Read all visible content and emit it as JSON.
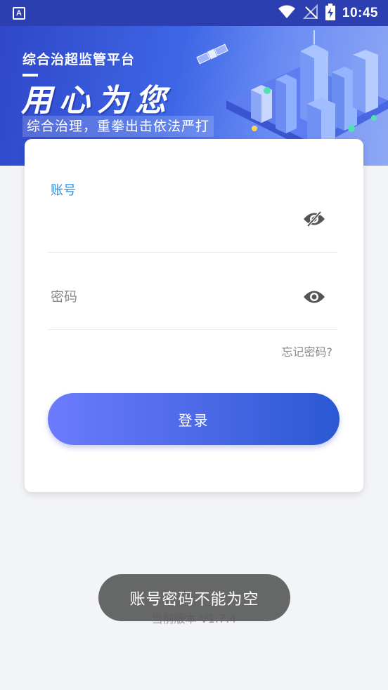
{
  "status_bar": {
    "app_badge": "A",
    "time": "10:45",
    "icons": [
      "wifi-icon",
      "no-signal-icon",
      "battery-charging-icon"
    ]
  },
  "banner": {
    "title": "综合治超监管平台",
    "slogan": "用心为您",
    "subtitle": "综合治理，重拳出击依法严打"
  },
  "login": {
    "account_label": "账号",
    "account_value": "",
    "password_placeholder": "密码",
    "account_eye_icon": "eye-off-icon",
    "password_eye_icon": "eye-icon",
    "forgot_password": "忘记密码?",
    "login_button": "登录"
  },
  "footer": {
    "version": "当前版本 V1.7.4"
  },
  "toast": {
    "message": "账号密码不能为空"
  },
  "colors": {
    "status_bar": "#2b3fb0",
    "accent_label": "#2f8fde",
    "button_start": "#6b7bfb",
    "button_end": "#2b58d3"
  }
}
